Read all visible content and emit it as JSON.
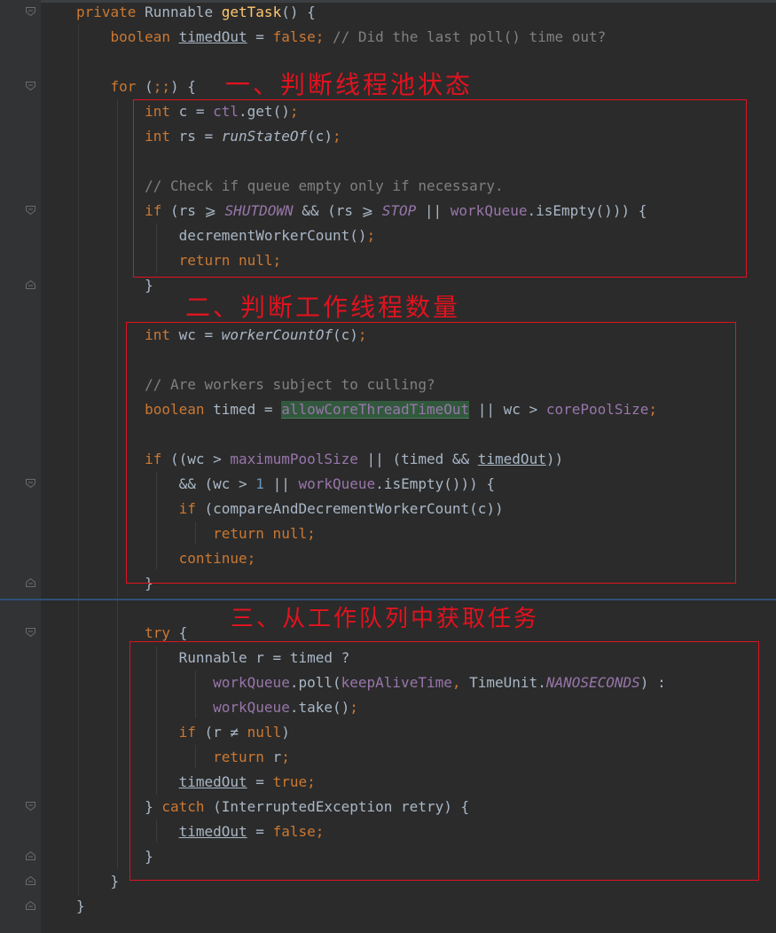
{
  "editor": {
    "code_lines": [
      [
        {
          "t": "private ",
          "c": "kw"
        },
        {
          "t": "Runnable "
        },
        {
          "t": "getTask",
          "c": "fn"
        },
        {
          "t": "() {"
        }
      ],
      [
        {
          "t": "    "
        },
        {
          "t": "boolean ",
          "c": "kw"
        },
        {
          "t": "timedOut",
          "c": "ul"
        },
        {
          "t": " = "
        },
        {
          "t": "false",
          "c": "kw"
        },
        {
          "t": "; ",
          "c": "kw"
        },
        {
          "t": "// Did the last poll() time out?",
          "c": "cmt"
        }
      ],
      [],
      [
        {
          "t": "    "
        },
        {
          "t": "for ",
          "c": "kw"
        },
        {
          "t": "("
        },
        {
          "t": ";;",
          "c": "kw"
        },
        {
          "t": ") {"
        }
      ],
      [
        {
          "t": "        "
        },
        {
          "t": "int ",
          "c": "kw"
        },
        {
          "t": "c = "
        },
        {
          "t": "ctl",
          "c": "fld"
        },
        {
          "t": ".get()"
        },
        {
          "t": ";",
          "c": "kw"
        }
      ],
      [
        {
          "t": "        "
        },
        {
          "t": "int ",
          "c": "kw"
        },
        {
          "t": "rs = "
        },
        {
          "t": "runStateOf",
          "c": "ital"
        },
        {
          "t": "(c)"
        },
        {
          "t": ";",
          "c": "kw"
        }
      ],
      [],
      [
        {
          "t": "        "
        },
        {
          "t": "// Check if queue empty only if necessary.",
          "c": "cmt"
        }
      ],
      [
        {
          "t": "        "
        },
        {
          "t": "if ",
          "c": "kw"
        },
        {
          "t": "(rs ⩾ "
        },
        {
          "t": "SHUTDOWN",
          "c": "fld ital"
        },
        {
          "t": " && (rs ⩾ "
        },
        {
          "t": "STOP",
          "c": "fld ital"
        },
        {
          "t": " || "
        },
        {
          "t": "workQueue",
          "c": "fld"
        },
        {
          "t": ".isEmpty())) {"
        }
      ],
      [
        {
          "t": "            decrementWorkerCount()"
        },
        {
          "t": ";",
          "c": "kw"
        }
      ],
      [
        {
          "t": "            "
        },
        {
          "t": "return null;",
          "c": "kw"
        }
      ],
      [
        {
          "t": "        }"
        }
      ],
      [],
      [
        {
          "t": "        "
        },
        {
          "t": "int ",
          "c": "kw"
        },
        {
          "t": "wc = "
        },
        {
          "t": "workerCountOf",
          "c": "ital"
        },
        {
          "t": "(c)"
        },
        {
          "t": ";",
          "c": "kw"
        }
      ],
      [],
      [
        {
          "t": "        "
        },
        {
          "t": "// Are workers subject to culling?",
          "c": "cmt"
        }
      ],
      [
        {
          "t": "        "
        },
        {
          "t": "boolean ",
          "c": "kw"
        },
        {
          "t": "timed = "
        },
        {
          "t": "allowCoreThreadTimeOut",
          "c": "fld hl"
        },
        {
          "t": " || wc > "
        },
        {
          "t": "corePoolSize",
          "c": "fld"
        },
        {
          "t": ";",
          "c": "kw"
        }
      ],
      [],
      [
        {
          "t": "        "
        },
        {
          "t": "if ",
          "c": "kw"
        },
        {
          "t": "((wc > "
        },
        {
          "t": "maximumPoolSize",
          "c": "fld"
        },
        {
          "t": " || (timed && "
        },
        {
          "t": "timedOut",
          "c": "ul"
        },
        {
          "t": "))"
        }
      ],
      [
        {
          "t": "            && (wc > "
        },
        {
          "t": "1",
          "c": "num"
        },
        {
          "t": " || "
        },
        {
          "t": "workQueue",
          "c": "fld"
        },
        {
          "t": ".isEmpty())) {"
        }
      ],
      [
        {
          "t": "            "
        },
        {
          "t": "if ",
          "c": "kw"
        },
        {
          "t": "(compareAndDecrementWorkerCount(c))"
        }
      ],
      [
        {
          "t": "                "
        },
        {
          "t": "return null;",
          "c": "kw"
        }
      ],
      [
        {
          "t": "            "
        },
        {
          "t": "continue;",
          "c": "kw"
        }
      ],
      [
        {
          "t": "        }"
        }
      ],
      [],
      [
        {
          "t": "        "
        },
        {
          "t": "try ",
          "c": "kw"
        },
        {
          "t": "{"
        }
      ],
      [
        {
          "t": "            Runnable r = timed ?"
        }
      ],
      [
        {
          "t": "                "
        },
        {
          "t": "workQueue",
          "c": "fld"
        },
        {
          "t": ".poll("
        },
        {
          "t": "keepAliveTime",
          "c": "fld"
        },
        {
          "t": ", ",
          "c": "kw"
        },
        {
          "t": "TimeUnit."
        },
        {
          "t": "NANOSECONDS",
          "c": "fld ital"
        },
        {
          "t": ") :"
        }
      ],
      [
        {
          "t": "                "
        },
        {
          "t": "workQueue",
          "c": "fld"
        },
        {
          "t": ".take()"
        },
        {
          "t": ";",
          "c": "kw"
        }
      ],
      [
        {
          "t": "            "
        },
        {
          "t": "if ",
          "c": "kw"
        },
        {
          "t": "(r ≠ "
        },
        {
          "t": "null",
          "c": "kw"
        },
        {
          "t": ")"
        }
      ],
      [
        {
          "t": "                "
        },
        {
          "t": "return ",
          "c": "kw"
        },
        {
          "t": "r"
        },
        {
          "t": ";",
          "c": "kw"
        }
      ],
      [
        {
          "t": "            "
        },
        {
          "t": "timedOut",
          "c": "ul"
        },
        {
          "t": " = "
        },
        {
          "t": "true;",
          "c": "kw"
        }
      ],
      [
        {
          "t": "        } "
        },
        {
          "t": "catch ",
          "c": "kw"
        },
        {
          "t": "(InterruptedException retry) {"
        }
      ],
      [
        {
          "t": "            "
        },
        {
          "t": "timedOut",
          "c": "ul"
        },
        {
          "t": " = "
        },
        {
          "t": "false;",
          "c": "kw"
        }
      ],
      [
        {
          "t": "        }"
        }
      ],
      [
        {
          "t": "    }"
        }
      ],
      [
        {
          "t": "}"
        }
      ]
    ],
    "colors": {
      "background": "#2b2b2b",
      "keyword": "#cc7832",
      "method": "#ffc66d",
      "field": "#9876aa",
      "comment": "#808080",
      "number": "#6897bb",
      "annotation": "#e0131f"
    }
  },
  "annotations": {
    "step1": "一、判断线程池状态",
    "step2": "二、判断工作线程数量",
    "step3": "三、从工作队列中获取任务"
  }
}
